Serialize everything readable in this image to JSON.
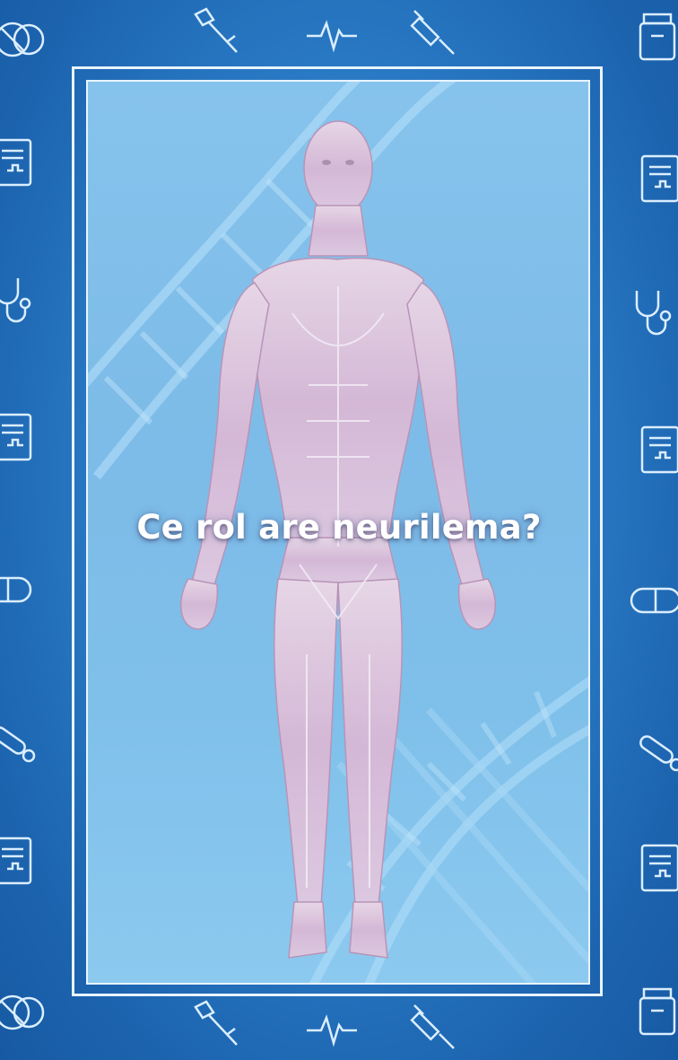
{
  "card": {
    "question": "Ce rol are neurilema?"
  },
  "colors": {
    "background": "#2b7cc7",
    "frame": "#e8f4ff",
    "panel": "#82bfea",
    "text": "#ffffff"
  },
  "icons": {
    "border": [
      "pills-icon",
      "crutch-icon",
      "heartbeat-icon",
      "syringe-icon",
      "medicine-bottle-icon",
      "medical-report-icon",
      "stethoscope-icon",
      "capsule-icon",
      "thermometer-icon"
    ],
    "illustration": "human-anatomy-figure",
    "backdrop": "dna-helix"
  }
}
